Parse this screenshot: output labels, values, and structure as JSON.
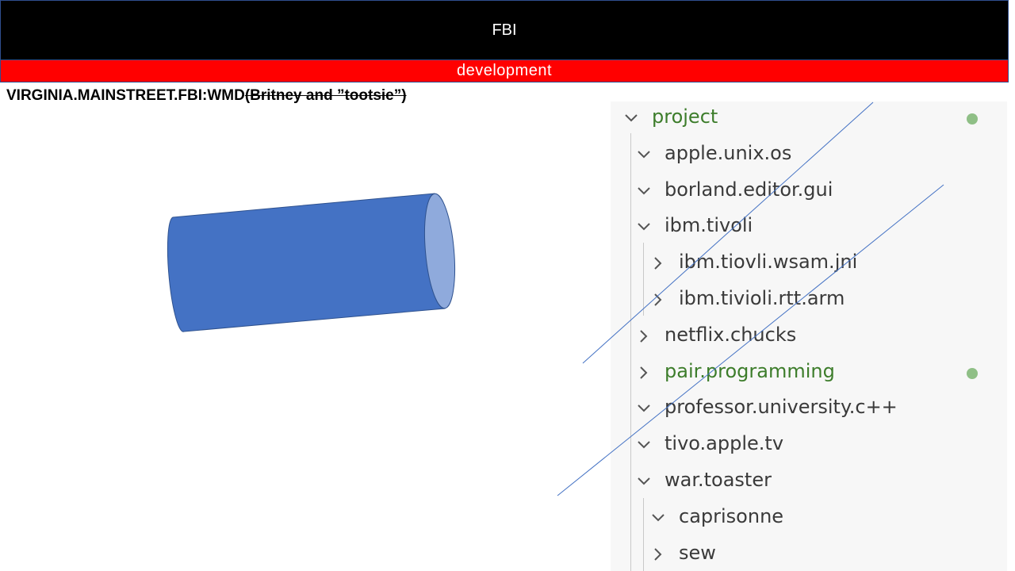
{
  "header": {
    "title": "FBI",
    "environment": "development",
    "title_bg": "#000000",
    "env_bg": "#ff0000"
  },
  "identifier": {
    "text": "VIRGINIA.MAINSTREET.FBI:WMD",
    "struck_text": "(Britney and ”tootsie”)"
  },
  "shape": {
    "kind": "cylinder",
    "fill": "#4472c4"
  },
  "tree": {
    "items": [
      {
        "label": "project",
        "expanded": true,
        "modified": true
      },
      {
        "label": "apple.unix.os",
        "expanded": true
      },
      {
        "label": "borland.editor.gui",
        "expanded": true
      },
      {
        "label": "ibm.tivoli",
        "expanded": true
      },
      {
        "label": "ibm.tiovli.wsam.jni",
        "expanded": false
      },
      {
        "label": "ibm.tivioli.rtt.arm",
        "expanded": false
      },
      {
        "label": "netflix.chucks",
        "expanded": false
      },
      {
        "label": "pair.programming",
        "expanded": false,
        "modified": true
      },
      {
        "label": "professor.university.c++",
        "expanded": true
      },
      {
        "label": "tivo.apple.tv",
        "expanded": true
      },
      {
        "label": "war.toaster",
        "expanded": true
      },
      {
        "label": "caprisonne",
        "expanded": true
      },
      {
        "label": "sew",
        "expanded": false
      }
    ],
    "modified_color": "#3d7d2b",
    "dot_color": "#8fbf86"
  }
}
